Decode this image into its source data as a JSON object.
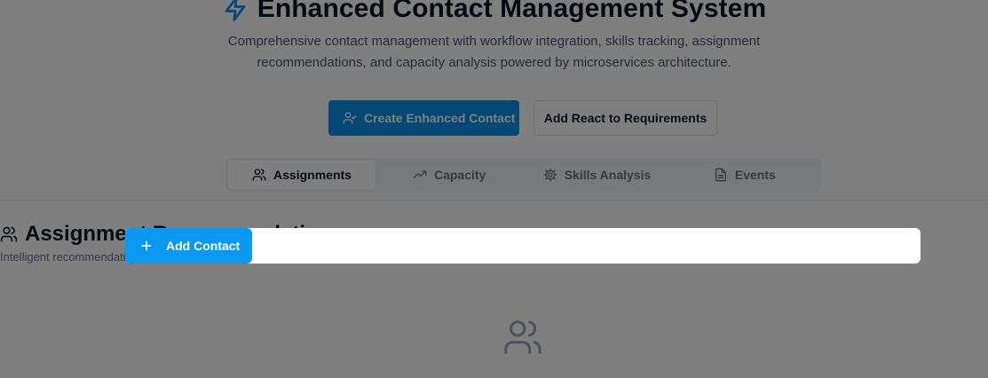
{
  "header": {
    "title": "Enhanced Contact Management System",
    "subtitle_line1": "Comprehensive contact management with workflow integration, skills tracking, assignment",
    "subtitle_line2": "recommendations, and capacity analysis powered by microservices architecture.",
    "title_icon": "zap-icon"
  },
  "actions": {
    "create_label": "Create Enhanced Contact",
    "create_icon": "user-check-icon",
    "requirements_label": "Add React to Requirements"
  },
  "tabs": [
    {
      "label": "Assignments",
      "icon": "users-icon",
      "active": true
    },
    {
      "label": "Capacity",
      "icon": "trending-up-icon",
      "active": false
    },
    {
      "label": "Skills Analysis",
      "icon": "gear-icon",
      "active": false
    },
    {
      "label": "Events",
      "icon": "file-text-icon",
      "active": false
    }
  ],
  "section": {
    "title": "Assignment Recommendations",
    "subtitle": "Intelligent recommendations based on skills, capacity and workload",
    "icon": "users-icon",
    "empty_icon": "users-icon"
  },
  "dialog": {
    "add_contact_label": "Add Contact",
    "add_icon": "plus-icon"
  },
  "colors": {
    "primary": "#0a8eea",
    "overlay": "rgba(0,0,0,0.5)"
  }
}
